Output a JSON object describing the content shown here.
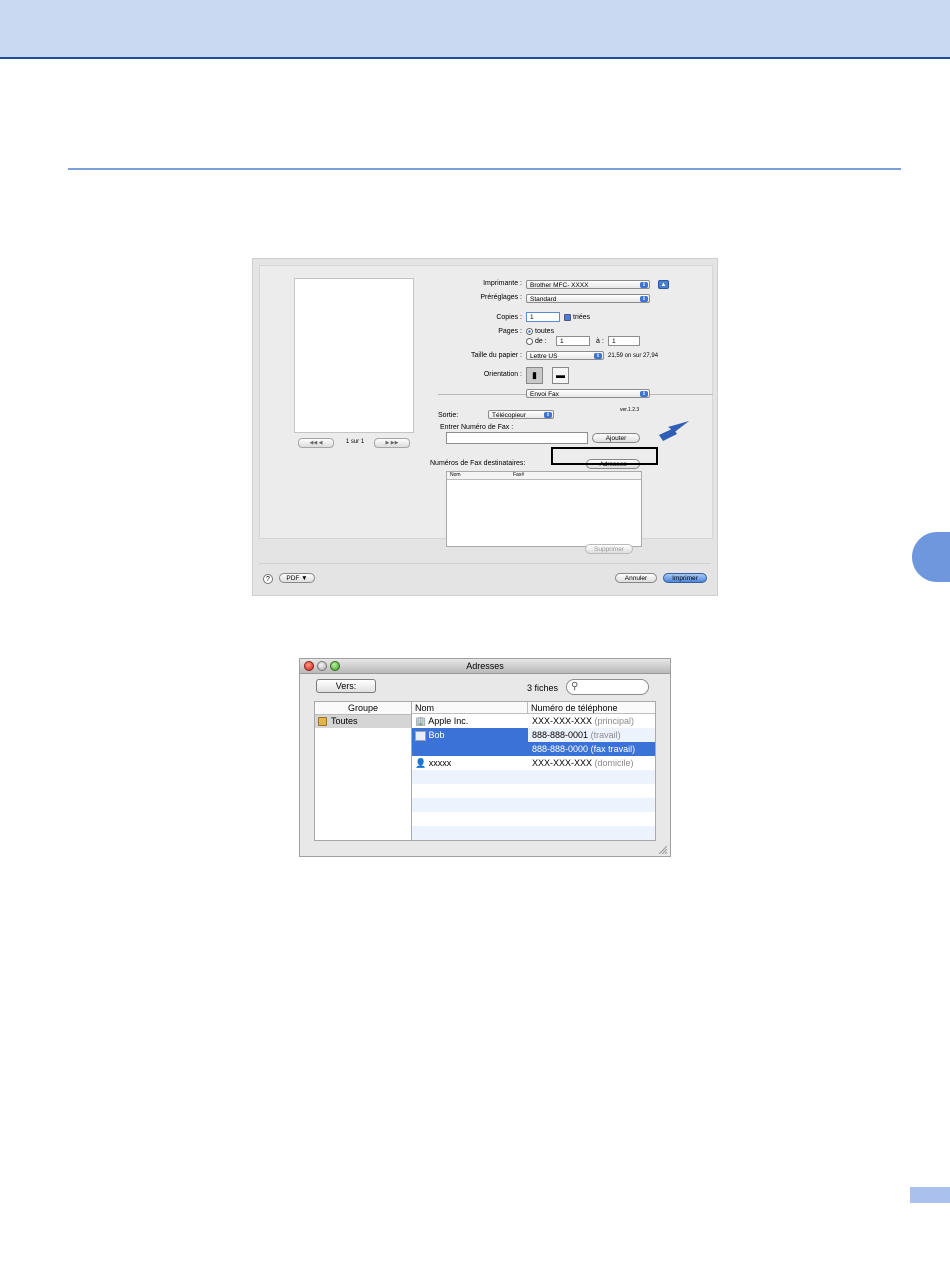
{
  "print_dialog": {
    "printer": {
      "label": "Imprimante :",
      "value": "Brother MFC- XXXX"
    },
    "presets": {
      "label": "Préréglages :",
      "value": "Standard"
    },
    "copies": {
      "label": "Copies :",
      "value": "1",
      "collated_label": "triées"
    },
    "pages": {
      "label": "Pages :",
      "all_label": "toutes",
      "from_label": "de :",
      "from_value": "1",
      "to_label": "à :",
      "to_value": "1"
    },
    "paper_size": {
      "label": "Taille du papier :",
      "value": "Lettre US",
      "dimensions": "21,59 on sur 27,94"
    },
    "orientation": {
      "label": "Orientation :"
    },
    "panel": {
      "value": "Envoi Fax"
    },
    "output": {
      "label": "Sortie:",
      "value": "Télécopieur",
      "version": "ver.1.2.3"
    },
    "fax_number": {
      "label": "Entrer Numéro de Fax :",
      "value": "",
      "add_label": "Ajouter"
    },
    "recipients": {
      "label": "Numéros de Fax destinataires:",
      "addresses_label": "Adresses",
      "columns": [
        "Nom",
        "Fax#"
      ]
    },
    "preview_page": "1 sur 1",
    "nav": {
      "prev": "◀◀  ◀",
      "next": "▶  ▶▶"
    },
    "delete_label": "Supprimer",
    "help_label": "?",
    "pdf_label": "PDF ▼",
    "cancel_label": "Annuler",
    "print_label": "Imprimer",
    "accent_color": "#3e73d1"
  },
  "address_book": {
    "title": "Adresses",
    "to_button": "Vers:",
    "count": "3 fiches",
    "search_placeholder": "",
    "group_header": "Groupe",
    "groups": [
      "Toutes"
    ],
    "name_header": "Nom",
    "phone_header": "Numéro de téléphone",
    "contacts": [
      {
        "name": "Apple Inc.",
        "icon": "building-icon",
        "phone": "XXX-XXX-XXX",
        "type": "(principal)"
      },
      {
        "name": "Bob",
        "icon": "contact-card-icon",
        "phone": "888-888-0001",
        "type": "(travail)"
      },
      {
        "name": "",
        "icon": "",
        "phone": "888-888-0000",
        "type": "(fax travail)"
      },
      {
        "name": "xxxxx",
        "icon": "person-icon",
        "phone": "XXX-XXX-XXX",
        "type": "(domicile)"
      }
    ],
    "selection_color": "#3a72d8"
  }
}
